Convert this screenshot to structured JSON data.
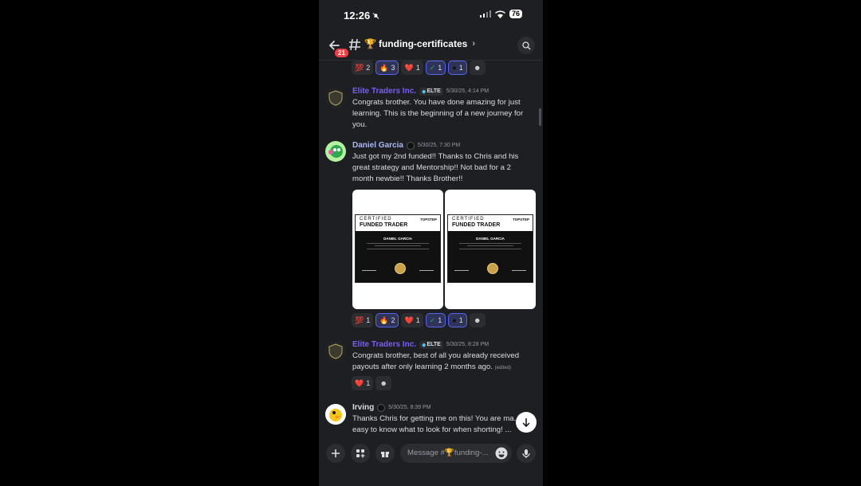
{
  "status": {
    "time": "12:26",
    "battery": "76"
  },
  "header": {
    "unread_badge": "21",
    "channel_emoji": "🏆",
    "channel_name": "funding-certificates",
    "chevron": "›"
  },
  "reactions_top": [
    {
      "emoji": "💯",
      "count": "2",
      "mine": false
    },
    {
      "emoji": "🔥",
      "count": "3",
      "mine": true
    },
    {
      "emoji": "❤️",
      "count": "1",
      "mine": false
    },
    {
      "emoji": "✓",
      "count": "1",
      "mine": true
    },
    {
      "emoji": "●",
      "count": "1",
      "mine": true
    }
  ],
  "messages": [
    {
      "author": "Elite Traders Inc.",
      "tag": "ELTE",
      "timestamp": "5/30/25, 4:14 PM",
      "text": "Congrats brother. You have done amazing for just learning. This is the beginning of a new journey for you."
    },
    {
      "author": "Daniel Garcia",
      "timestamp": "5/30/25, 7:30 PM",
      "text": "Just got my 2nd funded!! Thanks to Chris and his great strategy and Mentorship!! Not bad for a 2 month newbie!! Thanks Brother!!",
      "certificates": [
        {
          "certified": "CERTIFIED",
          "funded": "FUNDED TRADER",
          "logo": "TOPSTEP",
          "name": "DANIEL GARCIA"
        },
        {
          "certified": "CERTIFIED",
          "funded": "FUNDED TRADER",
          "logo": "TOPSTEP",
          "name": "DANIEL GARCIA"
        }
      ],
      "reactions": [
        {
          "emoji": "💯",
          "count": "1",
          "mine": false
        },
        {
          "emoji": "🔥",
          "count": "2",
          "mine": true
        },
        {
          "emoji": "❤️",
          "count": "1",
          "mine": false
        },
        {
          "emoji": "✓",
          "count": "1",
          "mine": true
        },
        {
          "emoji": "●",
          "count": "1",
          "mine": true
        }
      ]
    },
    {
      "author": "Elite Traders Inc.",
      "tag": "ELTE",
      "timestamp": "5/30/25, 8:28 PM",
      "text": "Congrats brother, best of all you already received payouts after only learning 2 months ago.",
      "edited": "(edited)",
      "reactions": [
        {
          "emoji": "❤️",
          "count": "1",
          "mine": false
        }
      ]
    },
    {
      "author": "Irving",
      "timestamp": "5/30/25, 8:39 PM",
      "text": "Thanks Chris for getting me on this! You are ma... it easy to know what to look for when shorting! ..."
    }
  ],
  "composer": {
    "placeholder": "Message #🏆funding-..."
  },
  "colors": {
    "background": "#1e1f22",
    "elite_author": "#7a5df5",
    "daniel_author": "#a9b8f7",
    "accent": "#5865f2"
  }
}
